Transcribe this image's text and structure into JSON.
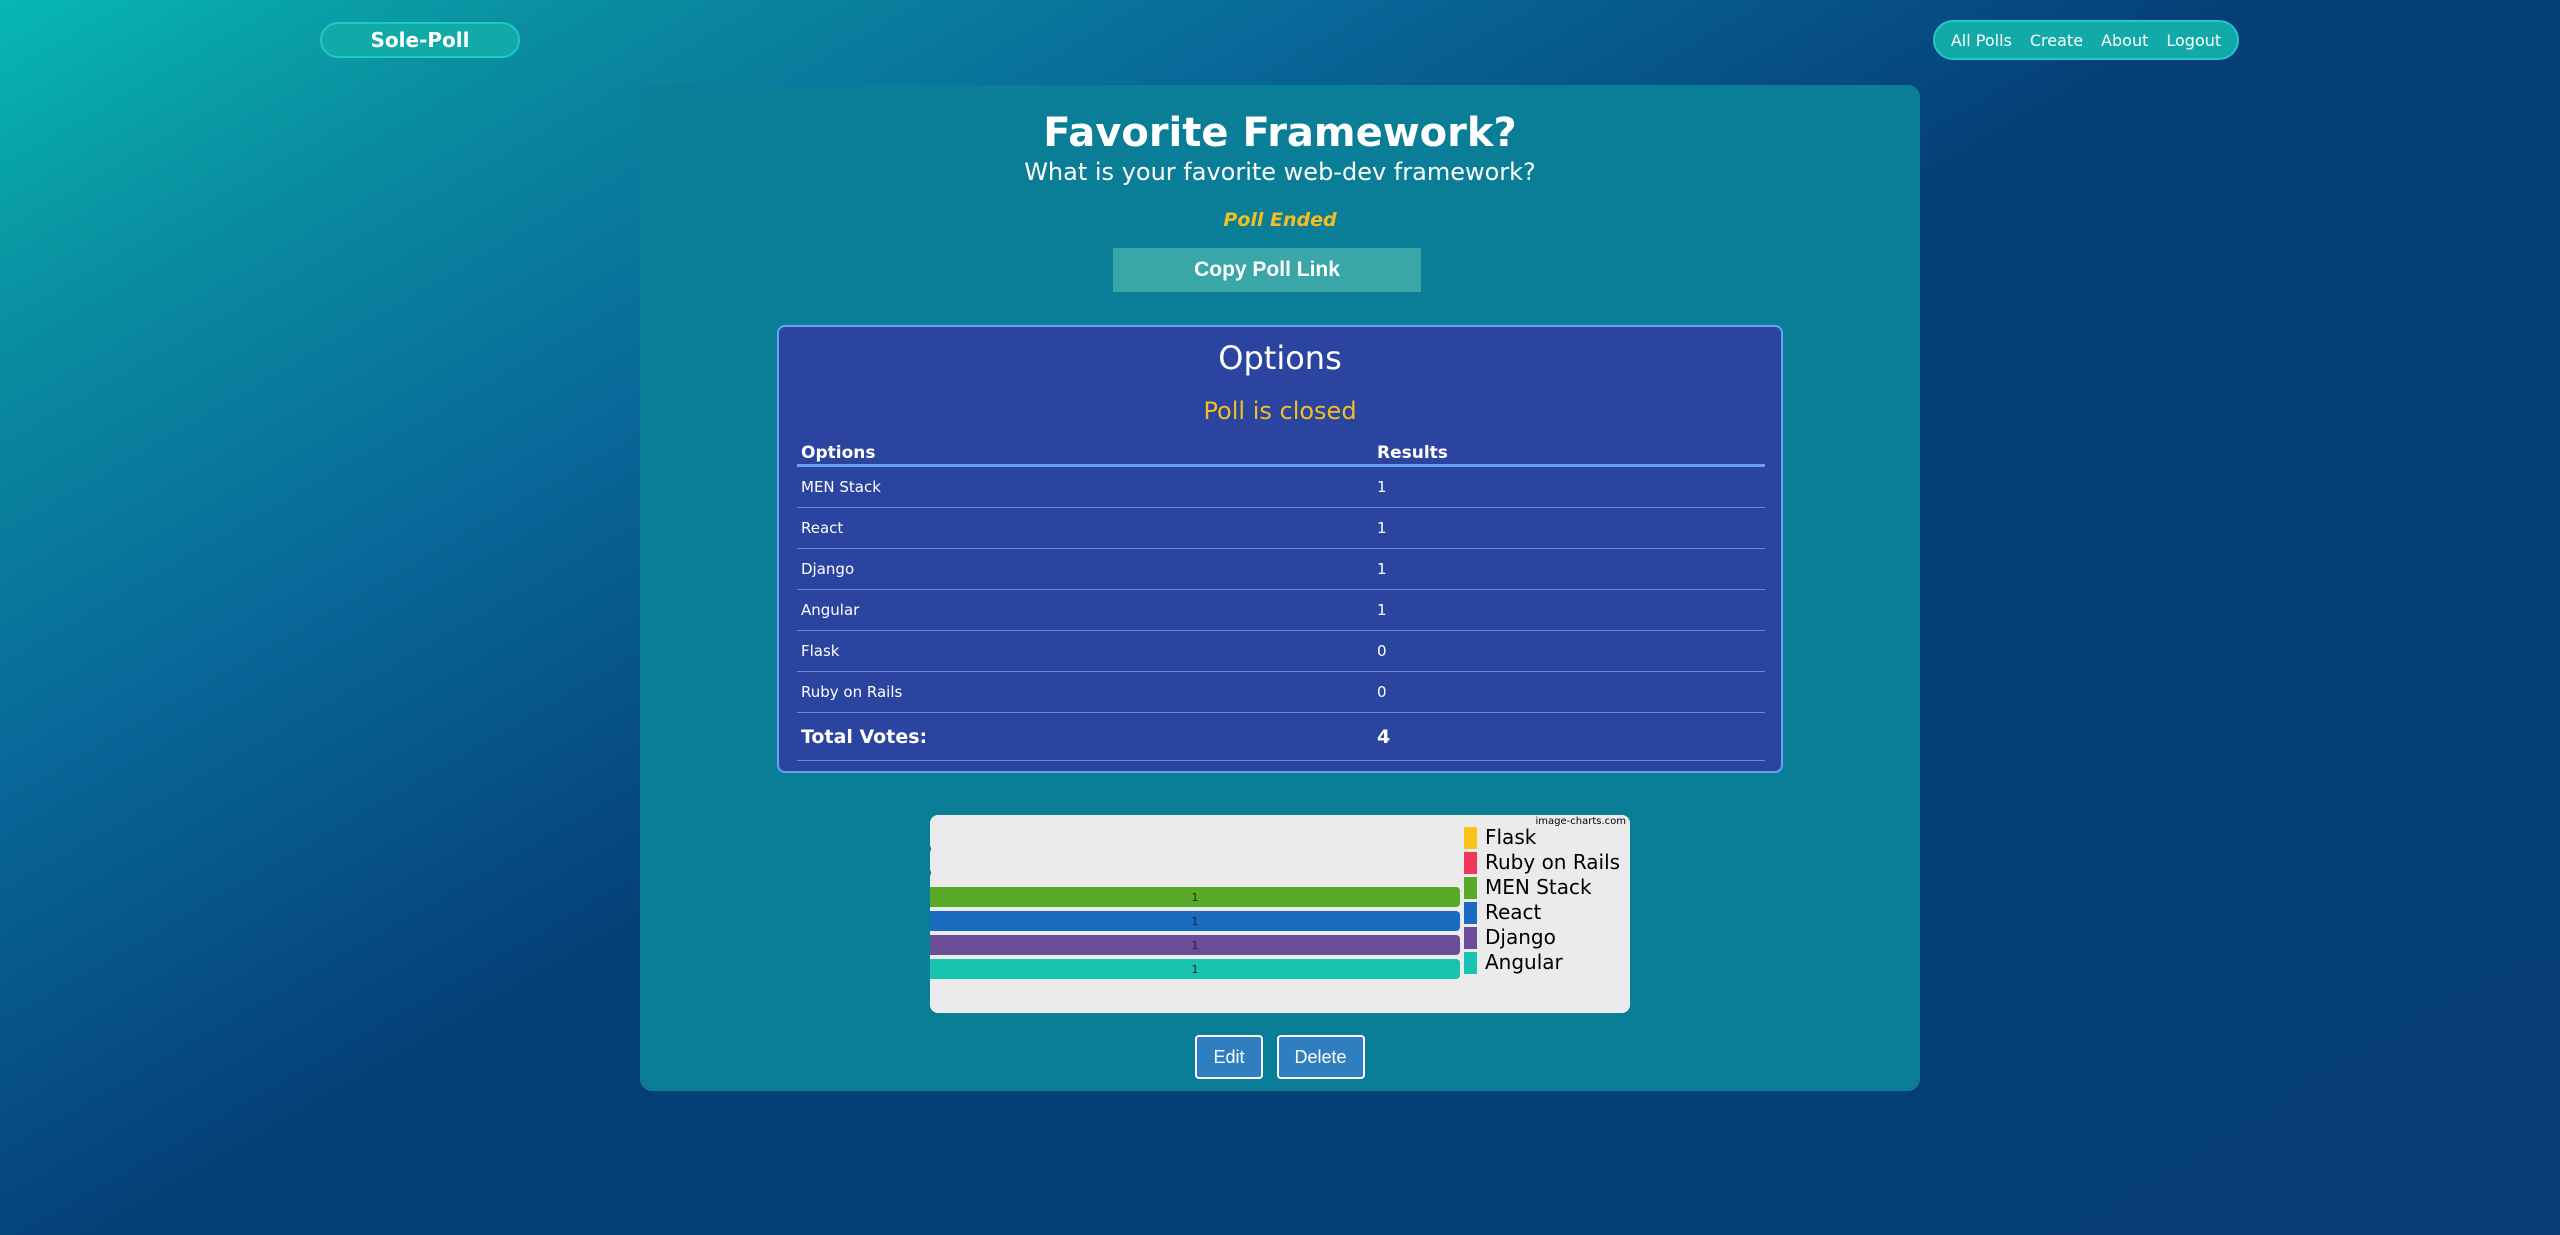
{
  "brand": "Sole-Poll",
  "nav": [
    "All Polls",
    "Create",
    "About",
    "Logout"
  ],
  "poll": {
    "title": "Favorite Framework?",
    "question": "What is your favorite web-dev framework?",
    "status": "Poll Ended",
    "copy_button": "Copy Poll Link"
  },
  "options_card": {
    "heading": "Options",
    "closed_text": "Poll is closed",
    "col_options": "Options",
    "col_results": "Results",
    "rows": [
      {
        "option": "MEN Stack",
        "result": "1"
      },
      {
        "option": "React",
        "result": "1"
      },
      {
        "option": "Django",
        "result": "1"
      },
      {
        "option": "Angular",
        "result": "1"
      },
      {
        "option": "Flask",
        "result": "0"
      },
      {
        "option": "Ruby on Rails",
        "result": "0"
      }
    ],
    "total_label": "Total Votes:",
    "total_value": "4"
  },
  "chart_data": {
    "type": "bar",
    "orientation": "horizontal",
    "watermark": "image-charts.com",
    "categories": [
      "Flask",
      "Ruby on Rails",
      "MEN Stack",
      "React",
      "Django",
      "Angular"
    ],
    "values": [
      0,
      0,
      1,
      1,
      1,
      1
    ],
    "colors": [
      "#f9c31a",
      "#f2365a",
      "#5aaa2a",
      "#1a6cc0",
      "#6a4c98",
      "#18c4b0"
    ],
    "xlim": [
      0,
      1
    ],
    "legend": "right",
    "grid": false
  },
  "actions": {
    "edit": "Edit",
    "delete": "Delete"
  }
}
